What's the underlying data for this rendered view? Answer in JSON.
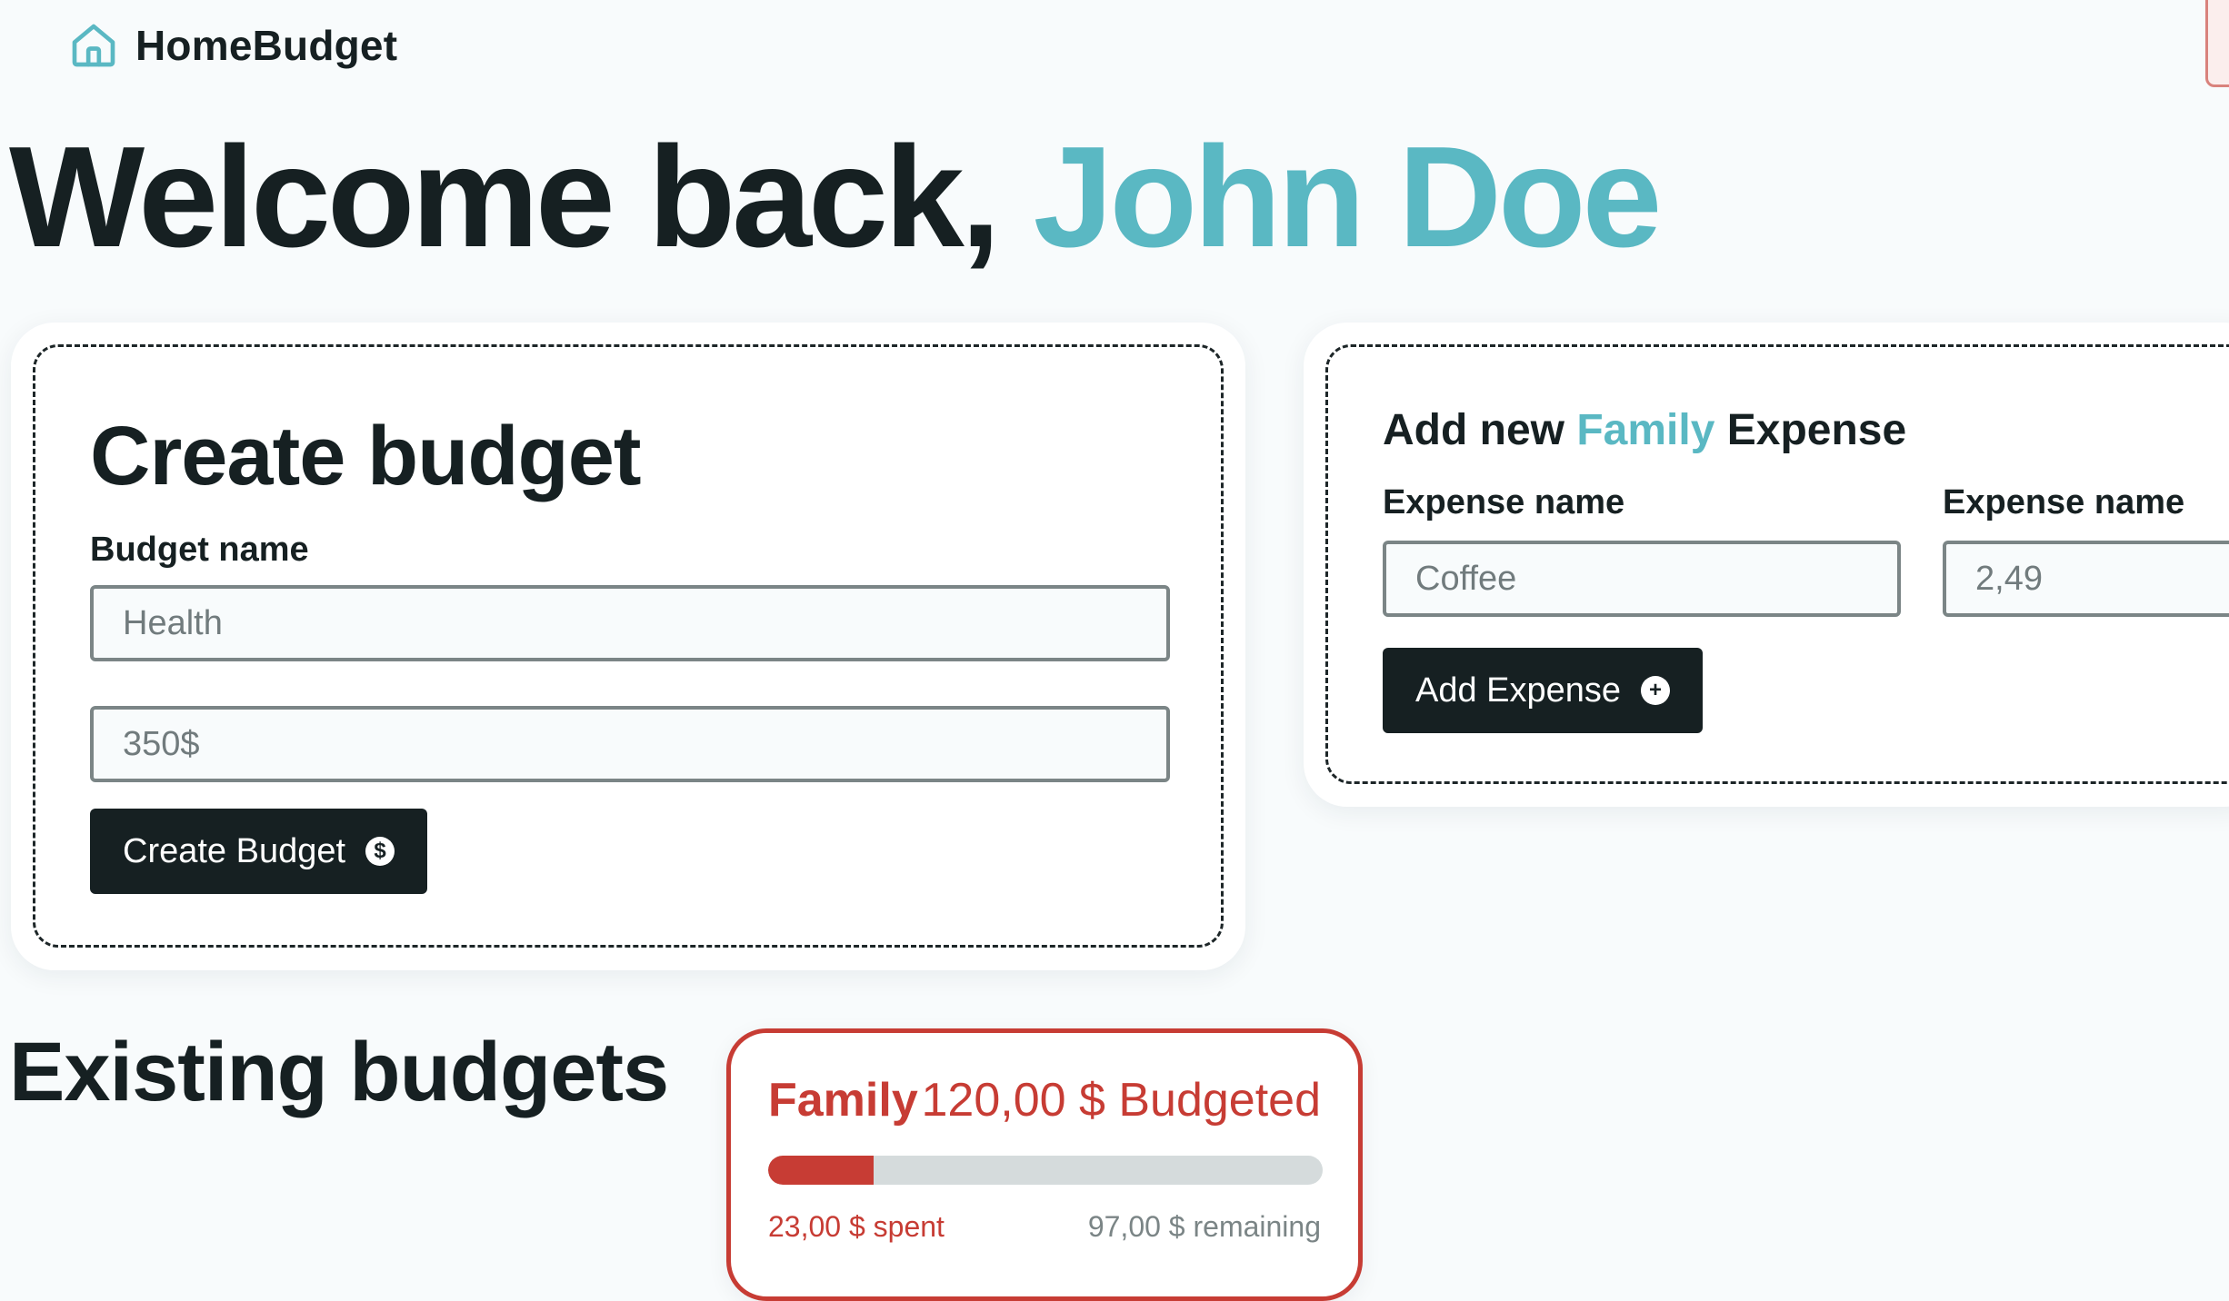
{
  "navbar": {
    "brand_name": "HomeBudget",
    "logo_icon": "home-icon"
  },
  "welcome": {
    "prefix": "Welcome back, ",
    "user_name": "John Doe"
  },
  "create_budget": {
    "title": "Create budget",
    "name_label": "Budget name",
    "name_placeholder": "Health",
    "amount_placeholder": "350$",
    "submit_label": "Create Budget",
    "submit_icon": "dollar-icon"
  },
  "add_expense": {
    "title_prefix": "Add new ",
    "budget_name": "Family",
    "title_suffix": " Expense",
    "name_label": "Expense name",
    "name_placeholder": "Coffee",
    "amount_label": "Expense name",
    "amount_placeholder": "2,49",
    "submit_label": "Add Expense",
    "submit_icon": "plus-icon"
  },
  "existing_budgets": {
    "title": "Existing budgets",
    "items": [
      {
        "name": "Family",
        "budgeted_text": "120,00 $ Budgeted",
        "spent_text": "23,00 $ spent",
        "remaining_text": "97,00 $ remaining",
        "progress": 0.19,
        "color": "#c73c34"
      }
    ]
  },
  "colors": {
    "accent": "#5ab8c3",
    "dark": "#162022",
    "budget_red": "#c73c34",
    "background": "#f8fbfc"
  }
}
